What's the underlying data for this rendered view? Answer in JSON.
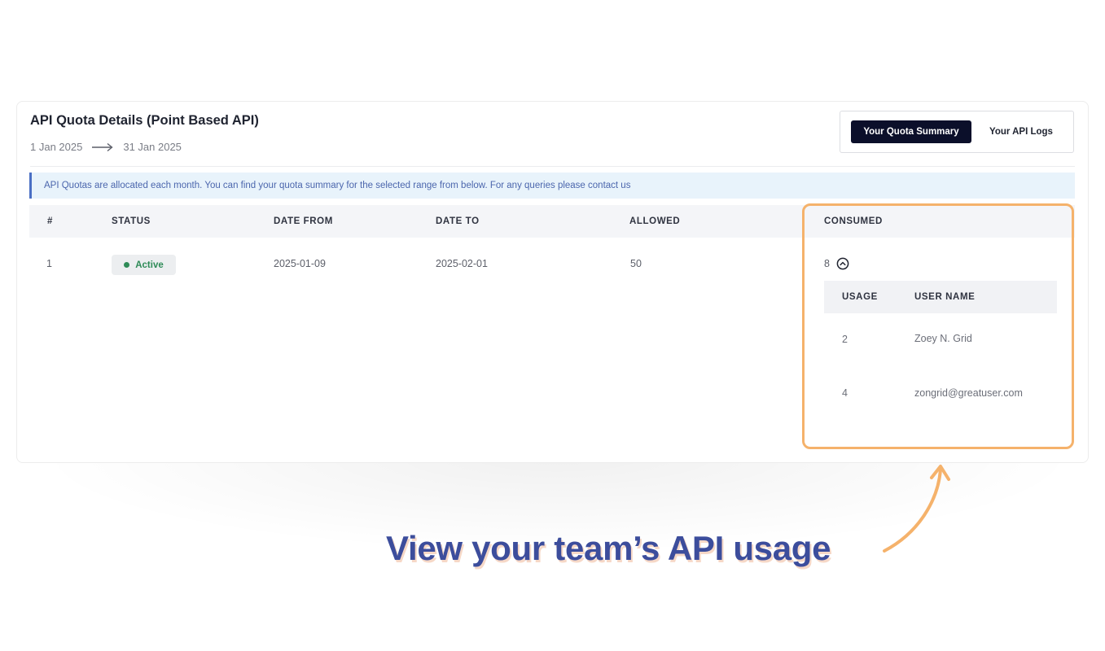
{
  "header": {
    "title": "API Quota Details (Point Based API)",
    "date_start": "1 Jan 2025",
    "date_end": "31 Jan 2025"
  },
  "tabs": {
    "active": "Your Quota Summary",
    "other": "Your API Logs"
  },
  "info_banner": "API Quotas are allocated each month. You can find your quota summary for the selected range from below. For any queries please contact us",
  "table": {
    "columns": [
      "#",
      "STATUS",
      "DATE FROM",
      "DATE TO",
      "ALLOWED",
      "CONSUMED"
    ],
    "rows": [
      {
        "index": "1",
        "status": "Active",
        "date_from": "2025-01-09",
        "date_to": "2025-02-01",
        "allowed": "50",
        "consumed": "8"
      }
    ]
  },
  "usage_breakdown": {
    "columns": [
      "USAGE",
      "USER NAME"
    ],
    "rows": [
      {
        "usage": "2",
        "user": "Zoey N. Grid"
      },
      {
        "usage": "4",
        "user": "zongrid@greatuser.com"
      }
    ]
  },
  "callout_text": "View your team’s API usage",
  "colors": {
    "accent_dark": "#0b0f2a",
    "status_active": "#2e8b57",
    "highlight": "#f5b26b",
    "callout": "#3c4d9c",
    "info_bg": "#e8f3fb"
  },
  "icons": [
    "arrow-right-icon",
    "chevron-up-circle-icon",
    "curved-arrow-icon"
  ]
}
